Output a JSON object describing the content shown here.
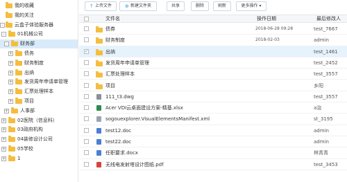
{
  "sidebar": {
    "items": [
      {
        "label": "我的收藏",
        "expander": "",
        "selected": false
      },
      {
        "label": "我的关注",
        "expander": "",
        "selected": false
      },
      {
        "label": "云盒子体验服务器",
        "expander": "-",
        "selected": false
      },
      {
        "label": "01机械公司",
        "expander": "-",
        "selected": false
      },
      {
        "label": "财务部",
        "expander": "-",
        "selected": true
      },
      {
        "label": "债务",
        "expander": "+",
        "selected": false
      },
      {
        "label": "财务制度",
        "expander": "+",
        "selected": false
      },
      {
        "label": "出纳",
        "expander": "+",
        "selected": false
      },
      {
        "label": "发货周年申请单管理",
        "expander": "+",
        "selected": false
      },
      {
        "label": "汇票处理样本",
        "expander": "+",
        "selected": false
      },
      {
        "label": "项目",
        "expander": "+",
        "selected": false
      },
      {
        "label": "人事部",
        "expander": "+",
        "selected": false
      },
      {
        "label": "02医院（信息科）",
        "expander": "+",
        "selected": false
      },
      {
        "label": "03政府机构",
        "expander": "+",
        "selected": false
      },
      {
        "label": "04装修设计公司",
        "expander": "+",
        "selected": false
      },
      {
        "label": "05学校",
        "expander": "+",
        "selected": false
      },
      {
        "label": "1",
        "expander": "+",
        "selected": false
      }
    ]
  },
  "toolbar": {
    "upload_label": "上传文件",
    "new_folder_label": "新建文件夹",
    "share_label": "共享",
    "delete_label": "删除",
    "refresh_label": "刷新",
    "more_label": "更多操作 ▾"
  },
  "table": {
    "headers": {
      "name": "文件名",
      "time": "操作日期",
      "user": "最后修改人"
    },
    "rows": [
      {
        "type": "folder",
        "name": "债券",
        "time": "2018-06-28 09:28",
        "user": "test_7667",
        "selected": false
      },
      {
        "type": "folder",
        "name": "财务制度",
        "time": "2018-02-03",
        "user": "admin",
        "selected": false
      },
      {
        "type": "folder",
        "name": "出纳",
        "time": "",
        "user": "test_1461",
        "selected": true
      },
      {
        "type": "folder",
        "name": "发货周年申请单管理",
        "time": "",
        "user": "test_2452",
        "selected": false
      },
      {
        "type": "folder",
        "name": "汇票处理样本",
        "time": "",
        "user": "test_3557",
        "selected": false
      },
      {
        "type": "folder",
        "name": "项目",
        "time": "",
        "user": "乡阳",
        "selected": false
      },
      {
        "type": "dwg",
        "name": "111_t3.dwg",
        "time": "",
        "user": "test_3557",
        "selected": false
      },
      {
        "type": "xls",
        "name": "Acer VDI云桌面建设方案-精基.xlsx",
        "time": "",
        "user": "a治",
        "selected": false
      },
      {
        "type": "xml",
        "name": "sogouexplorer.VisualElementsManifest.xml",
        "time": "",
        "user": "st_3195",
        "selected": false
      },
      {
        "type": "doc",
        "name": "test12.doc",
        "time": "",
        "user": "admin",
        "selected": false
      },
      {
        "type": "doc",
        "name": "test22.doc",
        "time": "",
        "user": "admin",
        "selected": false
      },
      {
        "type": "doc",
        "name": "任职要求.docx",
        "time": "",
        "user": "林青青",
        "selected": false
      },
      {
        "type": "pdf",
        "name": "无线电发射塔设计图纸.pdf",
        "time": "",
        "user": "test_3453",
        "selected": false
      }
    ]
  }
}
